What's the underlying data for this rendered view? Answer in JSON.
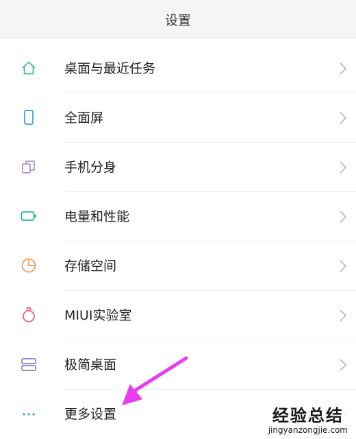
{
  "header": {
    "title": "设置"
  },
  "items": [
    {
      "label": "桌面与最近任务",
      "icon": "home-icon",
      "color": "#3bb5a7"
    },
    {
      "label": "全面屏",
      "icon": "phone-icon",
      "color": "#2e9fe0"
    },
    {
      "label": "手机分身",
      "icon": "clone-icon",
      "color": "#a98ee0"
    },
    {
      "label": "电量和性能",
      "icon": "battery-icon",
      "color": "#2cb6a2"
    },
    {
      "label": "存储空间",
      "icon": "pie-chart-icon",
      "color": "#ef9a57"
    },
    {
      "label": "MIUI实验室",
      "icon": "flask-icon",
      "color": "#e85c80"
    },
    {
      "label": "极简桌面",
      "icon": "layout-icon",
      "color": "#8a7ccf"
    },
    {
      "label": "更多设置",
      "icon": "more-icon",
      "color": "#2e9fe0"
    }
  ],
  "watermark": {
    "title": "经验总结",
    "url": "jingyanzongjie.com"
  },
  "annotation_color": "#e83cf0"
}
